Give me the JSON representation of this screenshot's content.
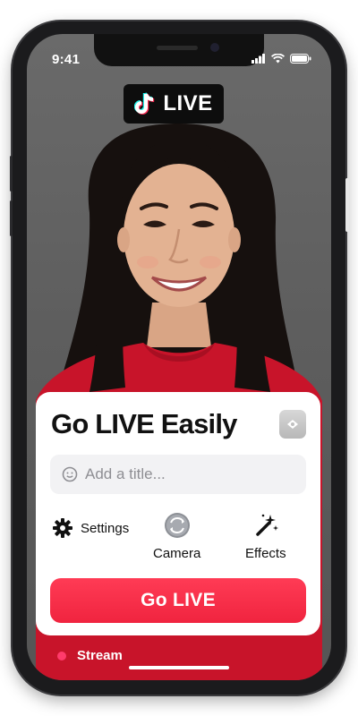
{
  "status_bar": {
    "time": "9:41",
    "icons": [
      "signal-icon",
      "wifi-icon",
      "battery-icon"
    ]
  },
  "live_badge": {
    "icon": "tiktok-note-icon",
    "label": "LIVE"
  },
  "card": {
    "title": "Go LIVE Easily",
    "logo_icon": "app-logo-icon",
    "title_input": {
      "icon": "smiley-icon",
      "placeholder": "Add a title...",
      "value": ""
    },
    "options": [
      {
        "label": "Settings",
        "icon": "gear-icon"
      },
      {
        "label": "Camera",
        "icon": "camera-flip-icon"
      },
      {
        "label": "Effects",
        "icon": "magic-wand-icon"
      }
    ],
    "go_live_button": "Go LIVE"
  },
  "bottom": {
    "stream_tab": "Stream"
  },
  "colors": {
    "accent": "#f0243f",
    "card_bg": "#ffffff",
    "input_bg": "#f2f2f4",
    "stream_dot": "#ff3b6b",
    "sweater": "#c8142a"
  }
}
